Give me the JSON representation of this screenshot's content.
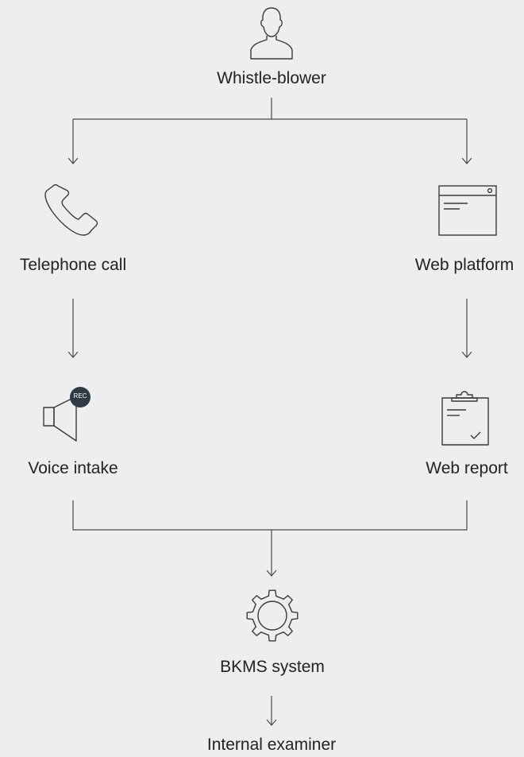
{
  "nodes": {
    "whistleblower": {
      "label": "Whistle-blower",
      "icon": "person-icon"
    },
    "telephone": {
      "label": "Telephone call",
      "icon": "phone-icon"
    },
    "web_platform": {
      "label": "Web platform",
      "icon": "browser-window-icon"
    },
    "voice_intake": {
      "label": "Voice intake",
      "icon": "speaker-icon",
      "badge": "REC"
    },
    "web_report": {
      "label": "Web report",
      "icon": "clipboard-icon"
    },
    "bkms": {
      "label": "BKMS system",
      "icon": "gear-icon"
    },
    "examiner": {
      "label": "Internal examiner"
    }
  },
  "colors": {
    "line": "#4a4a4a",
    "text": "#222222",
    "background": "#eceeef",
    "badge": "#2e3a44"
  }
}
